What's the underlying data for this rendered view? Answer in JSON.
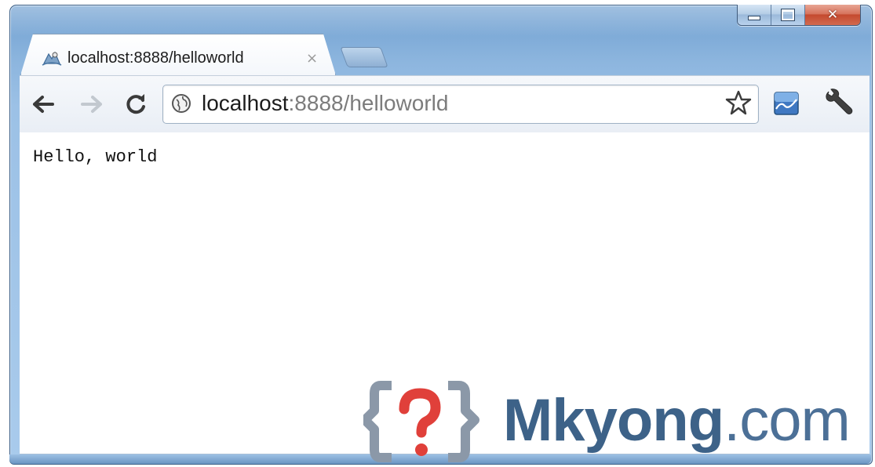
{
  "tab": {
    "title": "localhost:8888/helloworld",
    "close_glyph": "×",
    "favicon": "java-duke-icon"
  },
  "window_controls": {
    "minimize": "minimize-icon",
    "maximize": "maximize-icon",
    "close": "✕"
  },
  "toolbar": {
    "back": "back-arrow-icon",
    "forward": "forward-arrow-icon",
    "reload": "reload-icon",
    "omnibox": {
      "host": "localhost",
      "rest": ":8888/helloworld",
      "icon": "globe-icon"
    },
    "bookmark": "star-icon",
    "extension": "chart-extension-icon",
    "menu": "wrench-icon"
  },
  "page": {
    "text": "Hello, world"
  },
  "watermark": {
    "brand": "Mkyong",
    "suffix": ".com",
    "logo": "question-mark-logo-icon"
  },
  "colors": {
    "frame": "#8cb5de",
    "close_button": "#c44a2f",
    "watermark_blue": "#3d6288",
    "watermark_red": "#e0403a"
  }
}
